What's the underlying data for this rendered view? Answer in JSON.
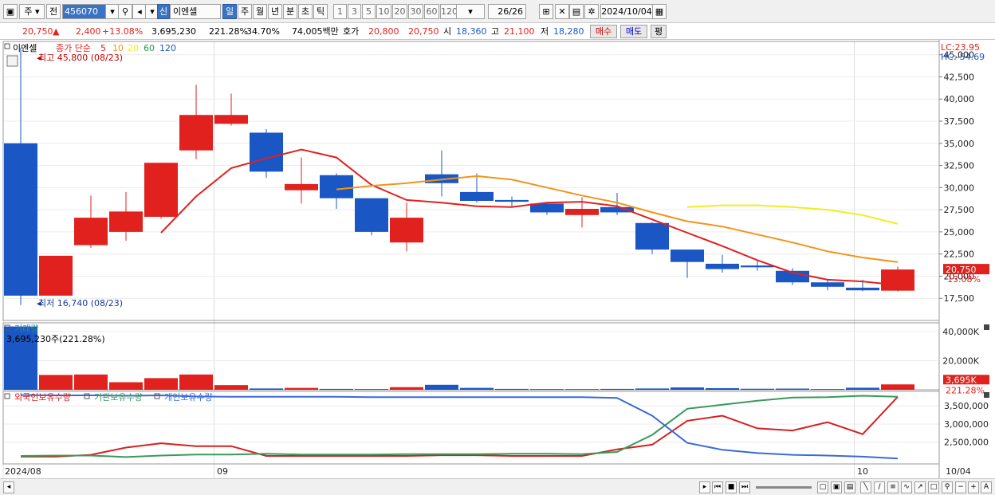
{
  "toolbar": {
    "type_select": "주",
    "prev_label": "전",
    "stock_code": "456070",
    "sin_badge": "신",
    "stock_name": "이엔셀",
    "period_tabs": [
      "일",
      "주",
      "월",
      "년",
      "분",
      "초",
      "틱"
    ],
    "active_period": "일",
    "interval_tabs": [
      "1",
      "3",
      "5",
      "10",
      "20",
      "30",
      "60",
      "120"
    ],
    "page_count": "26/26",
    "date": "2024/10/04"
  },
  "quote": {
    "price": "20,750",
    "arrow": "▲",
    "change": "2,400",
    "change_pct": "+13.08%",
    "volume": "3,695,230",
    "vol_ratio": "221.28%",
    "turnover": "34.70%",
    "amount": "74,005백만",
    "hoga_label": "호가",
    "ask": "20,800",
    "bid": "20,750",
    "open_label": "시",
    "open": "18,360",
    "high_label": "고",
    "high": "21,100",
    "low_label": "저",
    "low": "18,280",
    "buy_label": "매수",
    "sell_label": "매도",
    "avg_label": "평"
  },
  "colors": {
    "up": "#e0211d",
    "down": "#1a56c4",
    "ma5": "#e0211d",
    "ma10": "#f29418",
    "ma20": "#eeee22",
    "ma60": "#2a9a4a",
    "ma120": "#1a56c4",
    "foreign": "#d62020",
    "institution": "#3a9a5a",
    "individual": "#3a6ad8"
  },
  "chart_data": [
    {
      "type": "candlestick",
      "title": "이엔셀",
      "legend": {
        "label": "종가 단순",
        "periods": [
          "5",
          "10",
          "20",
          "60",
          "120"
        ]
      },
      "annotations": {
        "high": "최고 45,800 (08/23)",
        "low": "최저 16,740 (08/23)"
      },
      "right_labels": {
        "lc": "LC:23.95",
        "hc": "HC:-54.69",
        "price_tag": "20,750",
        "pct_tag": "13.08%"
      },
      "y_ticks": [
        "17,500",
        "20,000",
        "22,500",
        "25,000",
        "27,500",
        "30,000",
        "32,500",
        "35,000",
        "37,500",
        "40,000",
        "42,500",
        "45,000"
      ],
      "ylim": [
        15000,
        46500
      ],
      "x_labels": [
        "2024/08",
        "09",
        "10",
        "10/04"
      ],
      "candles": [
        {
          "o": 35000,
          "h": 45800,
          "l": 16740,
          "c": 17800
        },
        {
          "o": 17800,
          "h": 22300,
          "l": 17800,
          "c": 22300
        },
        {
          "o": 23500,
          "h": 29100,
          "l": 23200,
          "c": 26600
        },
        {
          "o": 25000,
          "h": 29500,
          "l": 24000,
          "c": 27300
        },
        {
          "o": 26700,
          "h": 32800,
          "l": 26500,
          "c": 32800
        },
        {
          "o": 34200,
          "h": 41600,
          "l": 33200,
          "c": 38200
        },
        {
          "o": 37200,
          "h": 40600,
          "l": 37000,
          "c": 38200
        },
        {
          "o": 36200,
          "h": 36600,
          "l": 31100,
          "c": 31800
        },
        {
          "o": 29700,
          "h": 33400,
          "l": 28200,
          "c": 30400
        },
        {
          "o": 31400,
          "h": 31600,
          "l": 27600,
          "c": 28800
        },
        {
          "o": 28800,
          "h": 28800,
          "l": 24600,
          "c": 25000
        },
        {
          "o": 23800,
          "h": 28300,
          "l": 22800,
          "c": 26600
        },
        {
          "o": 31500,
          "h": 34200,
          "l": 29000,
          "c": 30500
        },
        {
          "o": 29500,
          "h": 31600,
          "l": 28300,
          "c": 28500
        },
        {
          "o": 28600,
          "h": 29000,
          "l": 27800,
          "c": 28400
        },
        {
          "o": 28200,
          "h": 28200,
          "l": 26900,
          "c": 27200
        },
        {
          "o": 26900,
          "h": 28900,
          "l": 25500,
          "c": 27600
        },
        {
          "o": 27800,
          "h": 29400,
          "l": 26900,
          "c": 27200
        },
        {
          "o": 26000,
          "h": 26100,
          "l": 22500,
          "c": 23000
        },
        {
          "o": 23000,
          "h": 23000,
          "l": 19800,
          "c": 21600
        },
        {
          "o": 21400,
          "h": 22400,
          "l": 20400,
          "c": 20800
        },
        {
          "o": 21200,
          "h": 21700,
          "l": 20600,
          "c": 21000
        },
        {
          "o": 20600,
          "h": 20900,
          "l": 19000,
          "c": 19300
        },
        {
          "o": 19300,
          "h": 19600,
          "l": 18400,
          "c": 18800
        },
        {
          "o": 18700,
          "h": 19600,
          "l": 18300,
          "c": 18400
        },
        {
          "o": 18360,
          "h": 21100,
          "l": 18280,
          "c": 20750
        }
      ],
      "series": [
        {
          "name": "5",
          "values": [
            null,
            null,
            null,
            null,
            24900,
            29000,
            32200,
            33300,
            34300,
            33400,
            30300,
            28600,
            28300,
            27900,
            27800,
            28300,
            28400,
            27900,
            26400,
            24900,
            23400,
            21800,
            20400,
            19600,
            19400,
            19000
          ]
        },
        {
          "name": "10",
          "values": [
            null,
            null,
            null,
            null,
            null,
            null,
            null,
            null,
            null,
            29800,
            30200,
            30500,
            30900,
            31300,
            30900,
            30000,
            29100,
            28300,
            27200,
            26200,
            25600,
            24700,
            23800,
            22800,
            22100,
            21600
          ]
        },
        {
          "name": "20",
          "values": [
            null,
            null,
            null,
            null,
            null,
            null,
            null,
            null,
            null,
            null,
            null,
            null,
            null,
            null,
            null,
            null,
            null,
            null,
            null,
            27800,
            28000,
            28000,
            27800,
            27500,
            26900,
            25900
          ]
        }
      ]
    },
    {
      "type": "bar",
      "title": "거래량",
      "value_label": "3,695,230주(221.28%)",
      "y_ticks": [
        "20,000K",
        "40,000K"
      ],
      "ylim": [
        0,
        46000
      ],
      "right_labels": {
        "tag": "3,695K",
        "pct": "221.28%"
      },
      "unit": "K",
      "values": [
        43500,
        10200,
        10500,
        5200,
        8000,
        10500,
        3200,
        900,
        1300,
        600,
        500,
        1800,
        3400,
        1300,
        600,
        500,
        500,
        600,
        900,
        1600,
        1100,
        700,
        800,
        500,
        1400,
        3695
      ]
    },
    {
      "type": "line",
      "legend": [
        "외국인보유수량",
        "기관보유수량",
        "개인보유수량"
      ],
      "y_ticks": [
        "2,500,000",
        "3,000,000",
        "3,500,000"
      ],
      "ylim": [
        1900000,
        3900000
      ],
      "series": [
        {
          "name": "외국인보유수량",
          "values": [
            2100000,
            2100000,
            2150000,
            2350000,
            2470000,
            2390000,
            2390000,
            2120000,
            2120000,
            2120000,
            2120000,
            2120000,
            2140000,
            2140000,
            2120000,
            2120000,
            2120000,
            2300000,
            2430000,
            3090000,
            3230000,
            2880000,
            2820000,
            3050000,
            2720000,
            3750000
          ]
        },
        {
          "name": "기관보유수량",
          "values": [
            2120000,
            2130000,
            2130000,
            2090000,
            2130000,
            2160000,
            2160000,
            2180000,
            2160000,
            2160000,
            2160000,
            2170000,
            2170000,
            2170000,
            2180000,
            2180000,
            2170000,
            2230000,
            2700000,
            3420000,
            3530000,
            3640000,
            3730000,
            3740000,
            3780000,
            3750000
          ]
        },
        {
          "name": "개인보유수량",
          "values": [
            3800000,
            3790000,
            3790000,
            3780000,
            3790000,
            3760000,
            3750000,
            3750000,
            3750000,
            3750000,
            3740000,
            3740000,
            3740000,
            3740000,
            3740000,
            3740000,
            3740000,
            3720000,
            3230000,
            2480000,
            2290000,
            2200000,
            2150000,
            2130000,
            2100000,
            2050000
          ]
        }
      ]
    }
  ]
}
